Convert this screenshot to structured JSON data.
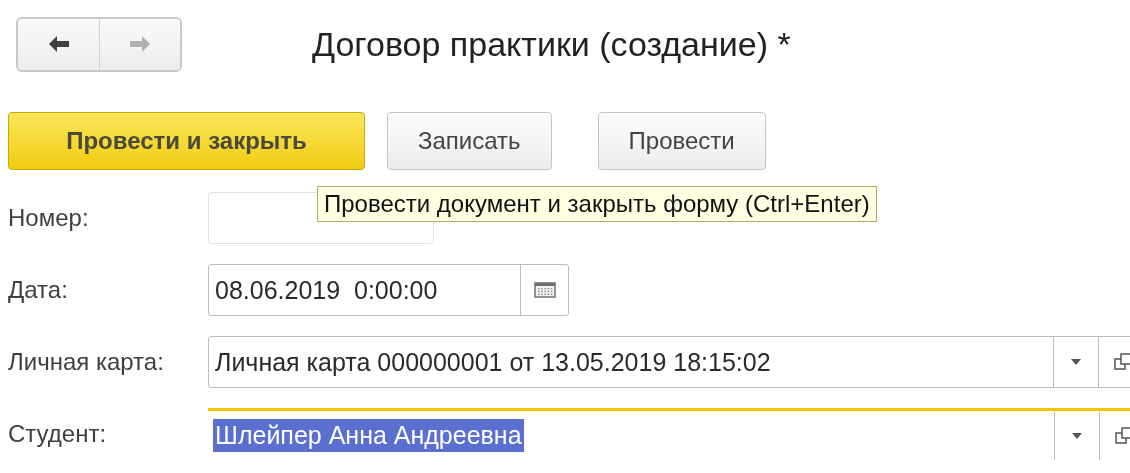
{
  "navigation": [
    {
      "kind": "back",
      "disabled": false
    },
    {
      "kind": "forward",
      "disabled": true
    }
  ],
  "window": {
    "title": "Договор практики (создание) *"
  },
  "buttons": [
    {
      "label": "Провести и закрыть",
      "primary": true
    },
    {
      "label": "Записать",
      "primary": false
    },
    {
      "label": "Провести",
      "primary": false
    }
  ],
  "tooltip": "Провести документ и закрыть форму (Ctrl+Enter)",
  "fields": [
    {
      "label": "Номер:",
      "kind": "text",
      "focused": false
    },
    {
      "label": "Дата:",
      "kind": "date",
      "value": "08.06.2019  0:00:00",
      "focused": false
    },
    {
      "label": "Личная карта:",
      "kind": "reference",
      "value": "Личная карта 000000001 от 13.05.2019 18:15:02",
      "focused": false
    },
    {
      "label": "Студент:",
      "kind": "reference",
      "value": "Шлейпер Анна Андреевна",
      "focused": true,
      "text_selected": true
    }
  ]
}
